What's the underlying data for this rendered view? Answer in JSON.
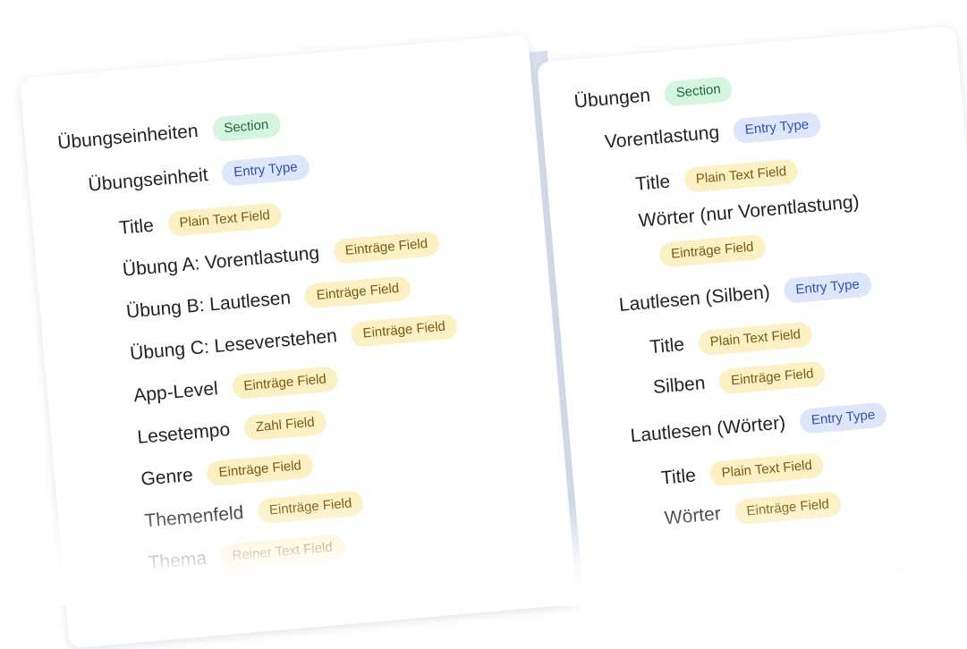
{
  "left": {
    "section": {
      "label": "Übungseinheiten",
      "badge": "Section"
    },
    "entry_type": {
      "label": "Übungseinheit",
      "badge": "Entry Type"
    },
    "fields": [
      {
        "label": "Title",
        "badge": "Plain Text Field"
      },
      {
        "label": "Übung A: Vorentlastung",
        "badge": "Einträge Field"
      },
      {
        "label": "Übung B: Lautlesen",
        "badge": "Einträge Field"
      },
      {
        "label": "Übung C: Leseverstehen",
        "badge": "Einträge Field"
      },
      {
        "label": "App-Level",
        "badge": "Einträge Field"
      },
      {
        "label": "Lesetempo",
        "badge": "Zahl Field"
      },
      {
        "label": "Genre",
        "badge": "Einträge Field"
      },
      {
        "label": "Themenfeld",
        "badge": "Einträge Field"
      },
      {
        "label": "Thema",
        "badge": "Reiner Text Field"
      }
    ]
  },
  "right": {
    "section": {
      "label": "Übungen",
      "badge": "Section"
    },
    "entry_types": [
      {
        "label": "Vorentlastung",
        "badge": "Entry Type",
        "fields": [
          {
            "label": "Title",
            "badge": "Plain Text Field"
          },
          {
            "label": "Wörter (nur Vorentlastung)",
            "badge": "Einträge Field"
          }
        ]
      },
      {
        "label": "Lautlesen (Silben)",
        "badge": "Entry Type",
        "fields": [
          {
            "label": "Title",
            "badge": "Plain Text Field"
          },
          {
            "label": "Silben",
            "badge": "Einträge Field"
          }
        ]
      },
      {
        "label": "Lautlesen (Wörter)",
        "badge": "Entry Type",
        "fields": [
          {
            "label": "Title",
            "badge": "Plain Text Field"
          },
          {
            "label": "Wörter",
            "badge": "Einträge Field"
          }
        ]
      }
    ]
  },
  "colors": {
    "section_bg": "#d6f5df",
    "entry_bg": "#dde6fb",
    "field_bg": "#fbf1c4"
  }
}
